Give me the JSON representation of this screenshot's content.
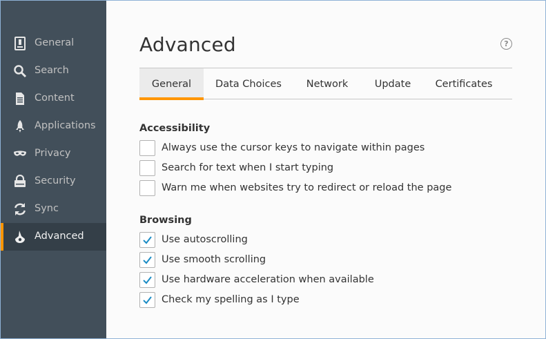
{
  "sidebar": {
    "items": [
      {
        "label": "General",
        "icon": "general-icon"
      },
      {
        "label": "Search",
        "icon": "search-icon"
      },
      {
        "label": "Content",
        "icon": "content-icon"
      },
      {
        "label": "Applications",
        "icon": "applications-icon"
      },
      {
        "label": "Privacy",
        "icon": "privacy-icon"
      },
      {
        "label": "Security",
        "icon": "security-icon"
      },
      {
        "label": "Sync",
        "icon": "sync-icon"
      },
      {
        "label": "Advanced",
        "icon": "advanced-icon",
        "selected": true
      }
    ]
  },
  "page": {
    "title": "Advanced",
    "help_icon": "?"
  },
  "tabs": [
    {
      "label": "General",
      "selected": true
    },
    {
      "label": "Data Choices"
    },
    {
      "label": "Network"
    },
    {
      "label": "Update"
    },
    {
      "label": "Certificates"
    }
  ],
  "accessibility": {
    "title": "Accessibility",
    "options": [
      {
        "label": "Always use the cursor keys to navigate within pages",
        "checked": false
      },
      {
        "label": "Search for text when I start typing",
        "checked": false
      },
      {
        "label": "Warn me when websites try to redirect or reload the page",
        "checked": false
      }
    ]
  },
  "browsing": {
    "title": "Browsing",
    "options": [
      {
        "label": "Use autoscrolling",
        "checked": true
      },
      {
        "label": "Use smooth scrolling",
        "checked": true
      },
      {
        "label": "Use hardware acceleration when available",
        "checked": true
      },
      {
        "label": "Check my spelling as I type",
        "checked": true
      }
    ]
  },
  "colors": {
    "sidebar_bg": "#424f5a",
    "sidebar_selected_bg": "#343f48",
    "accent": "#ff9500",
    "check": "#1b8cc5"
  }
}
